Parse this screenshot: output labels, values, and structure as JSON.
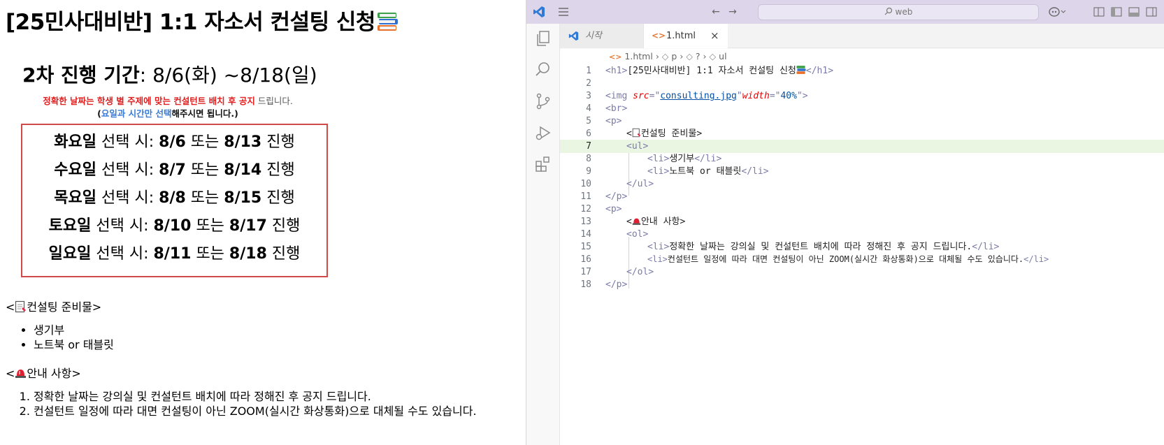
{
  "page": {
    "h1": "[25민사대비반] 1:1 자소서 컨설팅 신청",
    "poster": {
      "period_label": "2차 진행 기간",
      "period_value": ": 8/6(화) ~8/18(일)",
      "note1_red": "정확한 날짜는 학생 별 주제에 맞는 컨설턴트 배치 후 공지",
      "note1_rest": " 드립니다.",
      "note2_open": "(",
      "note2_blue": "요일과 시간만 선택",
      "note2_rest": "해주시면 됩니다.)",
      "schedule": [
        {
          "day": "화요일",
          "mid": " 선택 시: ",
          "d1": "8/6",
          "or": " 또는 ",
          "d2": "8/13",
          "end": " 진행"
        },
        {
          "day": "수요일",
          "mid": " 선택 시: ",
          "d1": "8/7",
          "or": " 또는 ",
          "d2": "8/14",
          "end": " 진행"
        },
        {
          "day": "목요일",
          "mid": " 선택 시: ",
          "d1": "8/8",
          "or": " 또는 ",
          "d2": "8/15",
          "end": " 진행"
        },
        {
          "day": "토요일",
          "mid": " 선택 시: ",
          "d1": "8/10",
          "or": " 또는 ",
          "d2": "8/17",
          "end": " 진행"
        },
        {
          "day": "일요일",
          "mid": " 선택 시: ",
          "d1": "8/11",
          "or": " 또는 ",
          "d2": "8/18",
          "end": " 진행"
        }
      ]
    },
    "prep_title_open": "<",
    "prep_title_text": "컨설팅 준비물>",
    "prep_items": [
      "생기부",
      "노트북 or 태블릿"
    ],
    "notice_title_open": "<",
    "notice_title_text": "안내 사항>",
    "notice_items": [
      "정확한 날짜는 강의실 및 컨설턴트 배치에 따라 정해진 후 공지 드립니다.",
      "컨설턴트 일정에 따라 대면 컨설팅이 아닌 ZOOM(실시간 화상통화)으로 대체될 수도 있습니다."
    ]
  },
  "vscode": {
    "search_placeholder": "web",
    "tabs": [
      {
        "label": "시작"
      },
      {
        "label": "1.html",
        "close": "×"
      }
    ],
    "breadcrumb": [
      "1.html",
      "p",
      "?",
      "ul"
    ],
    "breadcrumb_sep": "›",
    "code_lines": [
      {
        "n": "1"
      },
      {
        "n": "2"
      },
      {
        "n": "3"
      },
      {
        "n": "4"
      },
      {
        "n": "5"
      },
      {
        "n": "6"
      },
      {
        "n": "7"
      },
      {
        "n": "8"
      },
      {
        "n": "9"
      },
      {
        "n": "10"
      },
      {
        "n": "11"
      },
      {
        "n": "12"
      },
      {
        "n": "13"
      },
      {
        "n": "14"
      },
      {
        "n": "15"
      },
      {
        "n": "16"
      },
      {
        "n": "17"
      },
      {
        "n": "18"
      }
    ],
    "code": {
      "l1_open": "<h1>",
      "l1_text": "[25민사대비반] 1:1 자소서 컨설팅 신청",
      "l1_close": "</h1>",
      "l3_tag": "<img ",
      "l3_attr1": "src",
      "l3_eq1": "=\"",
      "l3_val1": "consulting.jpg",
      "l3_q1": "\"",
      "l3_attr2": "width",
      "l3_eq2": "=\"",
      "l3_val2": "40%",
      "l3_end": "\">",
      "l4": "<br>",
      "l5": "<p>",
      "l6_open": "<",
      "l6_text": "컨설팅 준비물>",
      "l7": "<ul>",
      "l8_open": "<li>",
      "l8_text": "생기부",
      "l8_close": "</li>",
      "l9_open": "<li>",
      "l9_text": "노트북 or 태블릿",
      "l9_close": "</li>",
      "l10": "</ul>",
      "l11": "</p>",
      "l12": "<p>",
      "l13_open": "<",
      "l13_text": "안내 사항>",
      "l14": "<ol>",
      "l15_open": "<li>",
      "l15_text": "정확한 날짜는 강의실 및 컨설턴트 배치에 따라 정해진 후 공지 드립니다.",
      "l15_close": "</li>",
      "l16_open": "<li>",
      "l16_text": "컨설턴트 일정에 따라 대면 컨설팅이 아닌 ZOOM(실시간 화상통화)으로 대체될 수도 있습니다.",
      "l16_close": "</li>",
      "l17": "</ol>",
      "l18": "</p>"
    }
  },
  "colors": {
    "titlebar": "#ddd6ea",
    "active_line": "#eaf6e2",
    "schedule_border": "#d04a4a",
    "note_red": "#e02020",
    "note_blue": "#3a7bd5",
    "vscode_blue": "#2f7ad6"
  },
  "icons": [
    "books-icon",
    "memo-icon",
    "siren-icon",
    "vscode-logo-icon",
    "menu-icon",
    "back-arrow-icon",
    "forward-arrow-icon",
    "search-icon",
    "copilot-icon",
    "layout-icon",
    "explorer-icon",
    "search-view-icon",
    "source-control-icon",
    "run-debug-icon",
    "extensions-icon",
    "html-file-icon",
    "close-icon"
  ]
}
